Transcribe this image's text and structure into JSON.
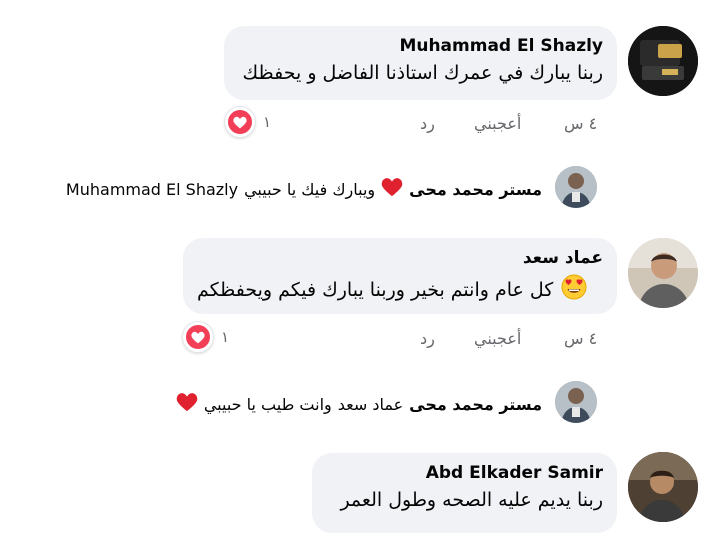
{
  "comments": [
    {
      "author": "Muhammad El Shazly",
      "text": "ربنا يبارك في عمرك استاذنا الفاضل و يحفظك",
      "time": "٤ س",
      "like_label": "أعجبني",
      "reply_label": "رد",
      "reaction_count": "١",
      "reply": {
        "author": "مستر محمد محى",
        "mention": "Muhammad El Shazly",
        "text": "ويبارك فيك يا حبيبي"
      }
    },
    {
      "author": "عماد سعد",
      "text": "كل عام وانتم بخير وربنا يبارك فيكم ويحفظكم",
      "time": "٤ س",
      "like_label": "أعجبني",
      "reply_label": "رد",
      "reaction_count": "١",
      "reply": {
        "author": "مستر محمد محى",
        "mention": "عماد سعد",
        "text": "وانت طيب يا حبيبي"
      }
    },
    {
      "author": "Abd Elkader Samir",
      "text": "ربنا يديم عليه الصحه وطول العمر"
    }
  ],
  "colors": {
    "bubble": "#f0f2f5",
    "heart": "#f33e58",
    "muted": "#65676b",
    "text": "#050505"
  },
  "icons": {
    "reaction": "heart-reaction-icon",
    "emoji_heart_eyes": "heart-eyes-emoji-icon",
    "emoji_heart": "red-heart-emoji-icon"
  }
}
